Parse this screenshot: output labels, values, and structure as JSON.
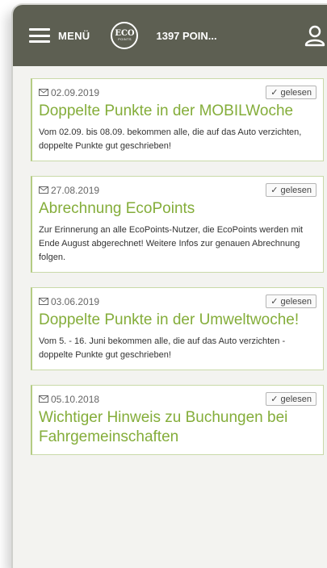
{
  "header": {
    "menu_label": "MENÜ",
    "logo_top": "ECO",
    "logo_bottom": "POINTS",
    "points": "1397 POIN..."
  },
  "messages": [
    {
      "date": "02.09.2019",
      "status": "✓ gelesen",
      "title": "Doppelte Punkte in der MOBILWoche",
      "body": "Vom 02.09. bis 08.09. bekommen alle, die auf das Auto verzichten, doppelte Punkte gut geschrieben!"
    },
    {
      "date": "27.08.2019",
      "status": "✓ gelesen",
      "title": "Abrechnung EcoPoints",
      "body": "Zur Erinnerung an alle EcoPoints-Nutzer, die EcoPoints werden mit Ende August abgerechnet! Weitere Infos zur genauen Abrechnung folgen."
    },
    {
      "date": "03.06.2019",
      "status": "✓ gelesen",
      "title": "Doppelte Punkte in der Umweltwoche!",
      "body": "Vom 5. - 16. Juni bekommen alle, die auf das Auto verzichten - doppelte Punkte gut geschrieben!"
    },
    {
      "date": "05.10.2018",
      "status": "✓ gelesen",
      "title": "Wichtiger Hinweis zu Buchungen bei Fahrgemeinschaften",
      "body": ""
    }
  ],
  "colors": {
    "header_bg": "#5d5f52",
    "title_green": "#84ad3a",
    "card_border": "#c9d9a8"
  }
}
